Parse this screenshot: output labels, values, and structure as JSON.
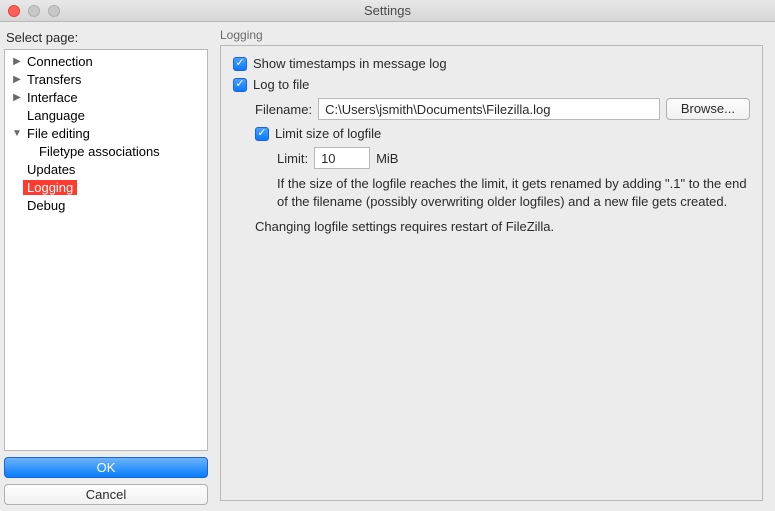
{
  "window": {
    "title": "Settings"
  },
  "sidebar": {
    "label": "Select page:",
    "items": [
      {
        "label": "Connection",
        "disclosure": "right",
        "level": 1
      },
      {
        "label": "Transfers",
        "disclosure": "right",
        "level": 1
      },
      {
        "label": "Interface",
        "disclosure": "right",
        "level": 1
      },
      {
        "label": "Language",
        "disclosure": "none",
        "level": 1
      },
      {
        "label": "File editing",
        "disclosure": "down",
        "level": 1
      },
      {
        "label": "Filetype associations",
        "disclosure": "none",
        "level": 2
      },
      {
        "label": "Updates",
        "disclosure": "none",
        "level": 1
      },
      {
        "label": "Logging",
        "disclosure": "none",
        "level": 1,
        "selected": true
      },
      {
        "label": "Debug",
        "disclosure": "none",
        "level": 1
      }
    ],
    "ok": "OK",
    "cancel": "Cancel"
  },
  "main": {
    "section_title": "Logging",
    "show_timestamps": {
      "checked": true,
      "label": "Show timestamps in message log"
    },
    "log_to_file": {
      "checked": true,
      "label": "Log to file"
    },
    "filename_label": "Filename:",
    "filename_value": "C:\\Users\\jsmith\\Documents\\Filezilla.log",
    "browse": "Browse...",
    "limit_size": {
      "checked": true,
      "label": "Limit size of logfile"
    },
    "limit_label": "Limit:",
    "limit_value": "10",
    "limit_unit": "MiB",
    "note1": "If the size of the logfile reaches the limit, it gets renamed by adding \".1\" to the end of the filename (possibly overwriting older logfiles) and a new file gets created.",
    "note2": "Changing logfile settings requires restart of FileZilla."
  }
}
